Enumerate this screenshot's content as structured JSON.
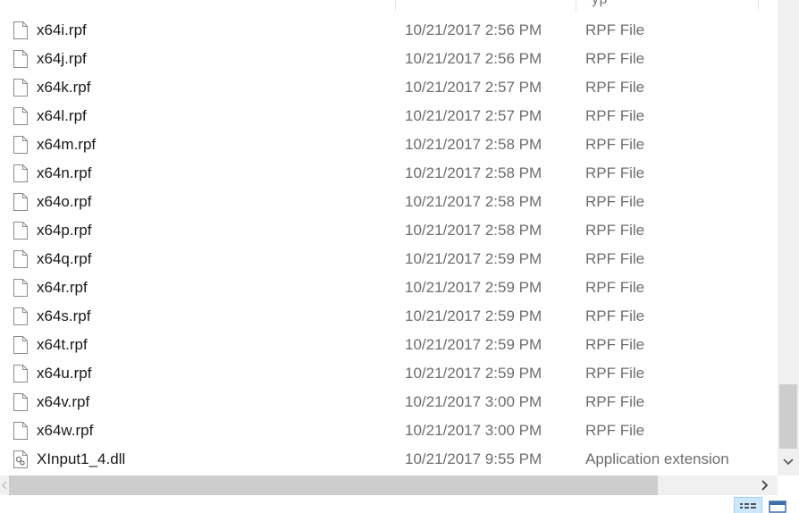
{
  "header": {
    "column_fragment": "yp"
  },
  "files": [
    {
      "name": "x64i.rpf",
      "date": "10/21/2017 2:56 PM",
      "type": "RPF File",
      "icon": "blank-file-icon"
    },
    {
      "name": "x64j.rpf",
      "date": "10/21/2017 2:56 PM",
      "type": "RPF File",
      "icon": "blank-file-icon"
    },
    {
      "name": "x64k.rpf",
      "date": "10/21/2017 2:57 PM",
      "type": "RPF File",
      "icon": "blank-file-icon"
    },
    {
      "name": "x64l.rpf",
      "date": "10/21/2017 2:57 PM",
      "type": "RPF File",
      "icon": "blank-file-icon"
    },
    {
      "name": "x64m.rpf",
      "date": "10/21/2017 2:58 PM",
      "type": "RPF File",
      "icon": "blank-file-icon"
    },
    {
      "name": "x64n.rpf",
      "date": "10/21/2017 2:58 PM",
      "type": "RPF File",
      "icon": "blank-file-icon"
    },
    {
      "name": "x64o.rpf",
      "date": "10/21/2017 2:58 PM",
      "type": "RPF File",
      "icon": "blank-file-icon"
    },
    {
      "name": "x64p.rpf",
      "date": "10/21/2017 2:58 PM",
      "type": "RPF File",
      "icon": "blank-file-icon"
    },
    {
      "name": "x64q.rpf",
      "date": "10/21/2017 2:59 PM",
      "type": "RPF File",
      "icon": "blank-file-icon"
    },
    {
      "name": "x64r.rpf",
      "date": "10/21/2017 2:59 PM",
      "type": "RPF File",
      "icon": "blank-file-icon"
    },
    {
      "name": "x64s.rpf",
      "date": "10/21/2017 2:59 PM",
      "type": "RPF File",
      "icon": "blank-file-icon"
    },
    {
      "name": "x64t.rpf",
      "date": "10/21/2017 2:59 PM",
      "type": "RPF File",
      "icon": "blank-file-icon"
    },
    {
      "name": "x64u.rpf",
      "date": "10/21/2017 2:59 PM",
      "type": "RPF File",
      "icon": "blank-file-icon"
    },
    {
      "name": "x64v.rpf",
      "date": "10/21/2017 3:00 PM",
      "type": "RPF File",
      "icon": "blank-file-icon"
    },
    {
      "name": "x64w.rpf",
      "date": "10/21/2017 3:00 PM",
      "type": "RPF File",
      "icon": "blank-file-icon"
    },
    {
      "name": "XInput1_4.dll",
      "date": "10/21/2017 9:55 PM",
      "type": "Application extension",
      "icon": "dll-file-icon"
    }
  ],
  "colors": {
    "name_text": "#1a1a1a",
    "meta_text": "#6d6d6d",
    "scrollbar_track": "#f0f0f0",
    "scrollbar_thumb": "#cdcdcd",
    "view_button_selected": "#cce8ff"
  },
  "icons": {
    "scroll_down": "chevron-down-icon",
    "scroll_right": "chevron-right-icon",
    "scroll_left": "chevron-left-icon",
    "details_view": "details-view-icon",
    "tiles_view": "large-icons-view-icon"
  }
}
